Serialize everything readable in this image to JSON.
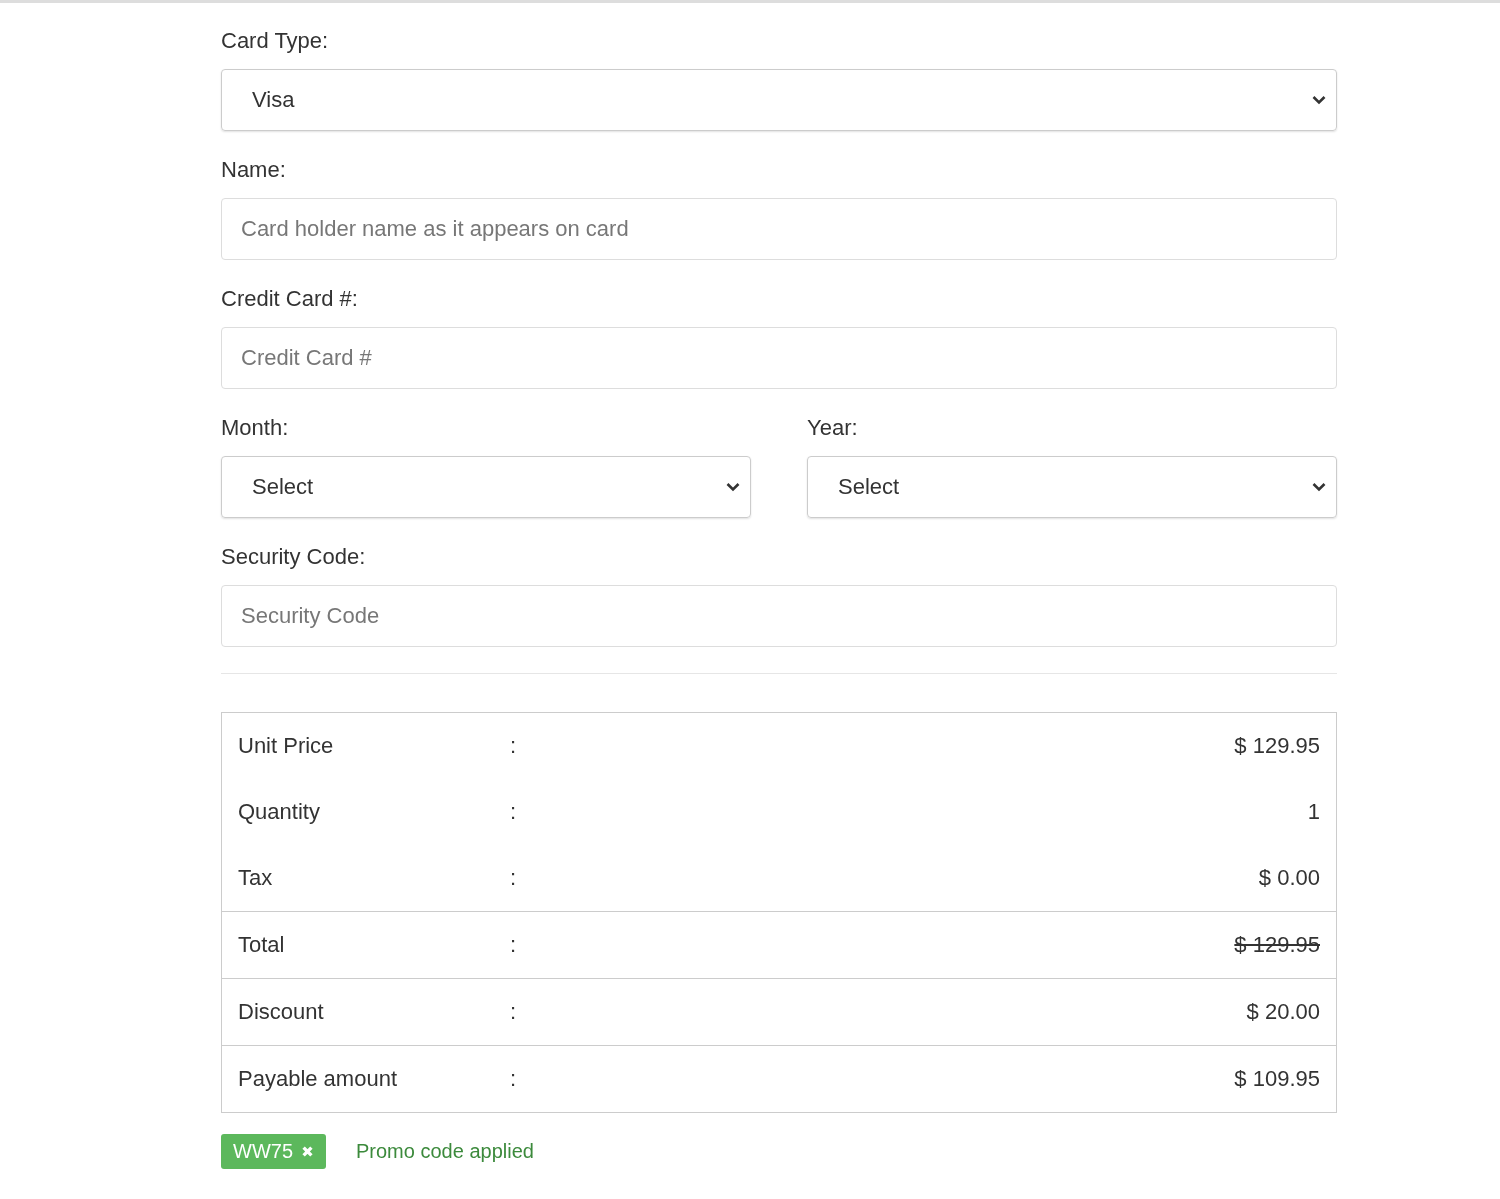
{
  "fields": [
    {
      "kind": "select",
      "label": "Card Type:",
      "value": "Visa"
    },
    {
      "kind": "text",
      "label": "Name:",
      "placeholder": "Card holder name as it appears on card"
    },
    {
      "kind": "text",
      "label": "Credit Card #:",
      "placeholder": "Credit Card #"
    },
    {
      "kind": "pair",
      "items": [
        {
          "kind": "select",
          "label": "Month:",
          "value": "Select"
        },
        {
          "kind": "select",
          "label": "Year:",
          "value": "Select"
        }
      ]
    },
    {
      "kind": "text",
      "label": "Security Code:",
      "placeholder": "Security Code"
    }
  ],
  "summary": {
    "sections": [
      [
        {
          "label": "Unit Price",
          "separator": ":",
          "value": "$ 129.95",
          "struck": false
        },
        {
          "label": "Quantity",
          "separator": ":",
          "value": "1",
          "struck": false
        },
        {
          "label": "Tax",
          "separator": ":",
          "value": "$ 0.00",
          "struck": false
        }
      ],
      [
        {
          "label": "Total",
          "separator": ":",
          "value": "$ 129.95",
          "struck": true
        }
      ],
      [
        {
          "label": "Discount",
          "separator": ":",
          "value": "$ 20.00",
          "struck": false
        }
      ],
      [
        {
          "label": "Payable amount",
          "separator": ":",
          "value": "$ 109.95",
          "struck": false
        }
      ]
    ]
  },
  "promo": {
    "code": "WW75",
    "message": "Promo code applied"
  }
}
